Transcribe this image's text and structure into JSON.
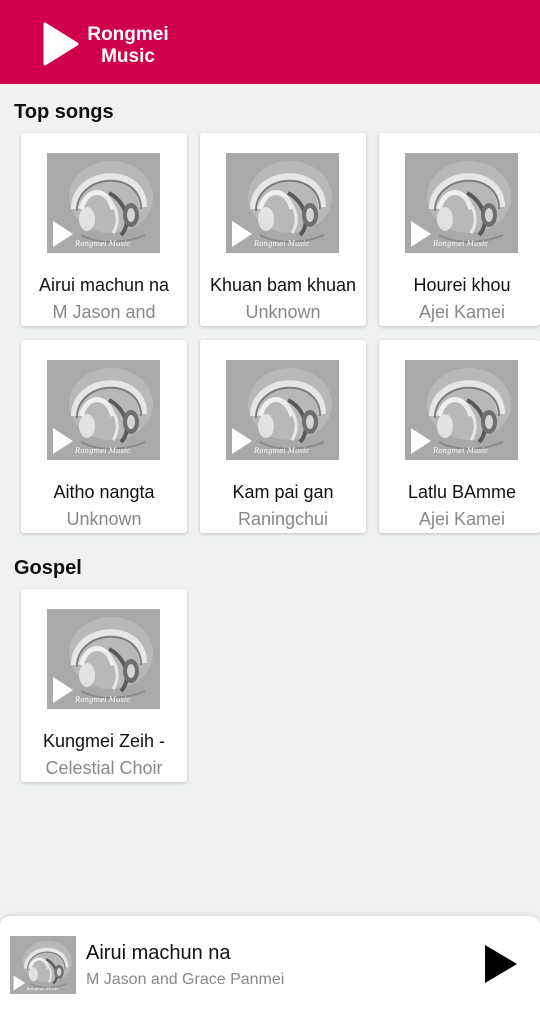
{
  "app": {
    "title_line1": "Rongmei",
    "title_line2": "Music",
    "accent_color": "#d1004a",
    "logo_icon": "play-triangle-icon"
  },
  "sections": [
    {
      "title": "Top songs",
      "songs": [
        {
          "title": "Airui machun na",
          "artist": "M Jason and"
        },
        {
          "title": "Khuan bam khuan",
          "artist": "Unknown"
        },
        {
          "title": "Hourei khou",
          "artist": "Ajei Kamei"
        },
        {
          "title": "Aitho nangta",
          "artist": "Unknown"
        },
        {
          "title": "Kam pai gan",
          "artist": "Raningchui"
        },
        {
          "title": "Latlu BAmme",
          "artist": "Ajei Kamei"
        }
      ]
    },
    {
      "title": "Gospel",
      "songs": [
        {
          "title": "Kungmei Zeih -",
          "artist": "Celestial Choir"
        }
      ]
    }
  ],
  "thumbnail": {
    "watermark": "Rongmei Music",
    "icon": "headphones-icon"
  },
  "player": {
    "title": "Airui machun na",
    "artist": "M Jason and Grace Panmei",
    "watermark": "Rongmei Music",
    "play_icon": "play-icon"
  }
}
